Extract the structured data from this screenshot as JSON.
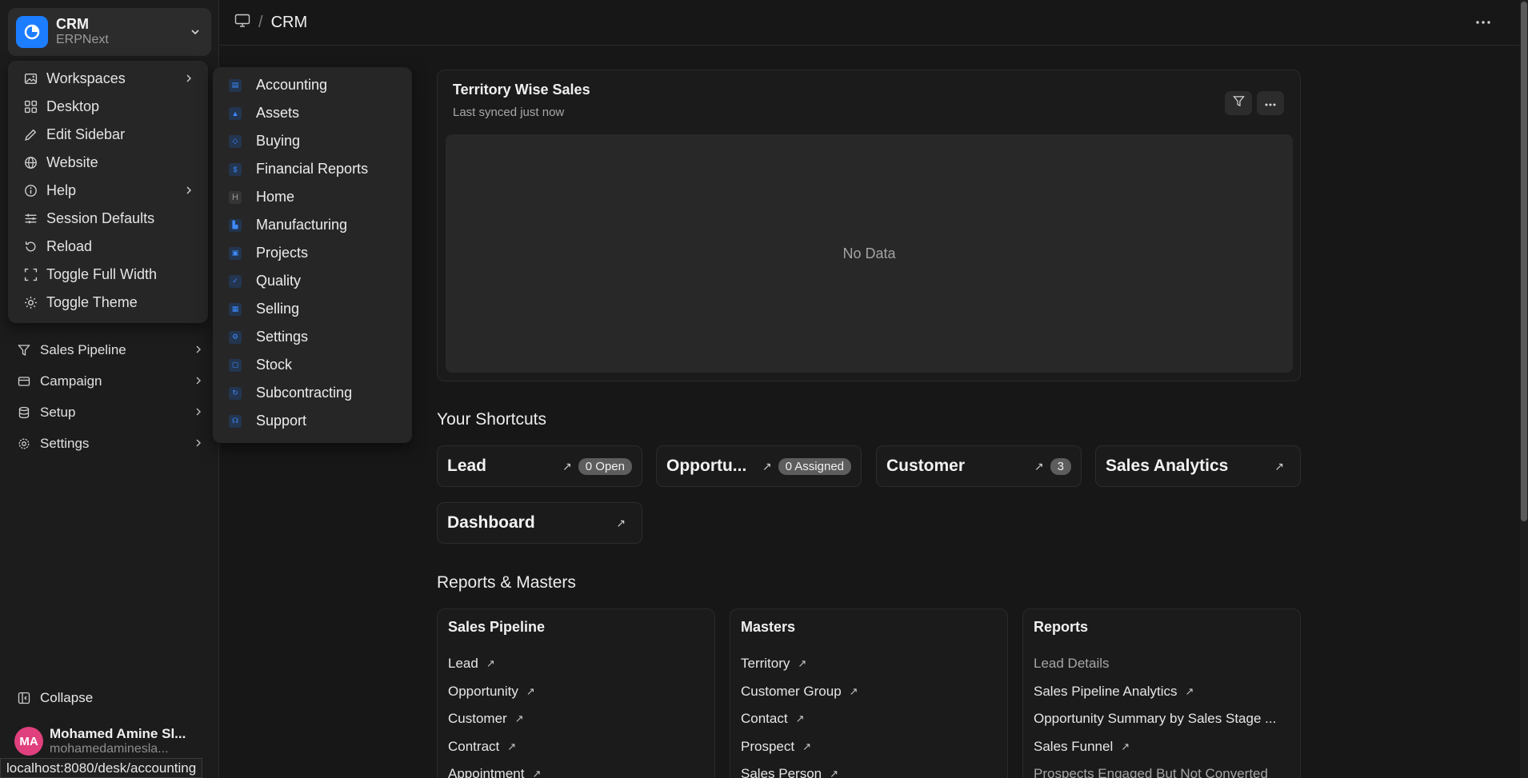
{
  "app": {
    "title": "CRM",
    "subtitle": "ERPNext",
    "accent": "#1d7dff"
  },
  "dropdown": [
    {
      "label": "Workspaces",
      "icon": "image-icon",
      "submenu": true
    },
    {
      "label": "Desktop",
      "icon": "grid-icon"
    },
    {
      "label": "Edit Sidebar",
      "icon": "pencil-icon"
    },
    {
      "label": "Website",
      "icon": "globe-icon"
    },
    {
      "label": "Help",
      "icon": "info-icon",
      "submenu": true
    },
    {
      "label": "Session Defaults",
      "icon": "sliders-icon"
    },
    {
      "label": "Reload",
      "icon": "reload-icon"
    },
    {
      "label": "Toggle Full Width",
      "icon": "expand-icon"
    },
    {
      "label": "Toggle Theme",
      "icon": "sun-icon"
    }
  ],
  "workspaces": [
    "Accounting",
    "Assets",
    "Buying",
    "Financial Reports",
    "Home",
    "Manufacturing",
    "Projects",
    "Quality",
    "Selling",
    "Settings",
    "Stock",
    "Subcontracting",
    "Support"
  ],
  "home_letter": "H",
  "sidebar": {
    "items": [
      {
        "label": "Sales Pipeline",
        "icon": "filter-icon"
      },
      {
        "label": "Campaign",
        "icon": "card-icon"
      },
      {
        "label": "Setup",
        "icon": "database-icon"
      },
      {
        "label": "Settings",
        "icon": "gear-icon"
      }
    ],
    "collapse_label": "Collapse"
  },
  "user": {
    "initials": "MA",
    "name": "Mohamed Amine Sl...",
    "email": "mohamedaminesla..."
  },
  "breadcrumb": {
    "title": "CRM",
    "separator": "/"
  },
  "chart_card": {
    "title": "Territory Wise Sales",
    "subtitle": "Last synced just now",
    "empty_text": "No Data"
  },
  "shortcuts_title": "Your Shortcuts",
  "shortcuts": [
    {
      "label": "Lead",
      "badge": "0 Open"
    },
    {
      "label": "Opportu...",
      "badge": "0 Assigned"
    },
    {
      "label": "Customer",
      "badge": "3"
    },
    {
      "label": "Sales Analytics",
      "badge": ""
    },
    {
      "label": "Dashboard",
      "badge": ""
    }
  ],
  "reports_title": "Reports & Masters",
  "report_cards": [
    {
      "title": "Sales Pipeline",
      "links": [
        "Lead",
        "Opportunity",
        "Customer",
        "Contract",
        "Appointment"
      ]
    },
    {
      "title": "Masters",
      "links": [
        "Territory",
        "Customer Group",
        "Contact",
        "Prospect",
        "Sales Person"
      ]
    },
    {
      "title": "Reports",
      "links": [
        "Lead Details",
        "Sales Pipeline Analytics",
        "Opportunity Summary by Sales Stage ...",
        "Sales Funnel",
        "Prospects Engaged But Not Converted"
      ]
    }
  ],
  "arrow_glyph": "↗",
  "status_url": "localhost:8080/desk/accounting"
}
